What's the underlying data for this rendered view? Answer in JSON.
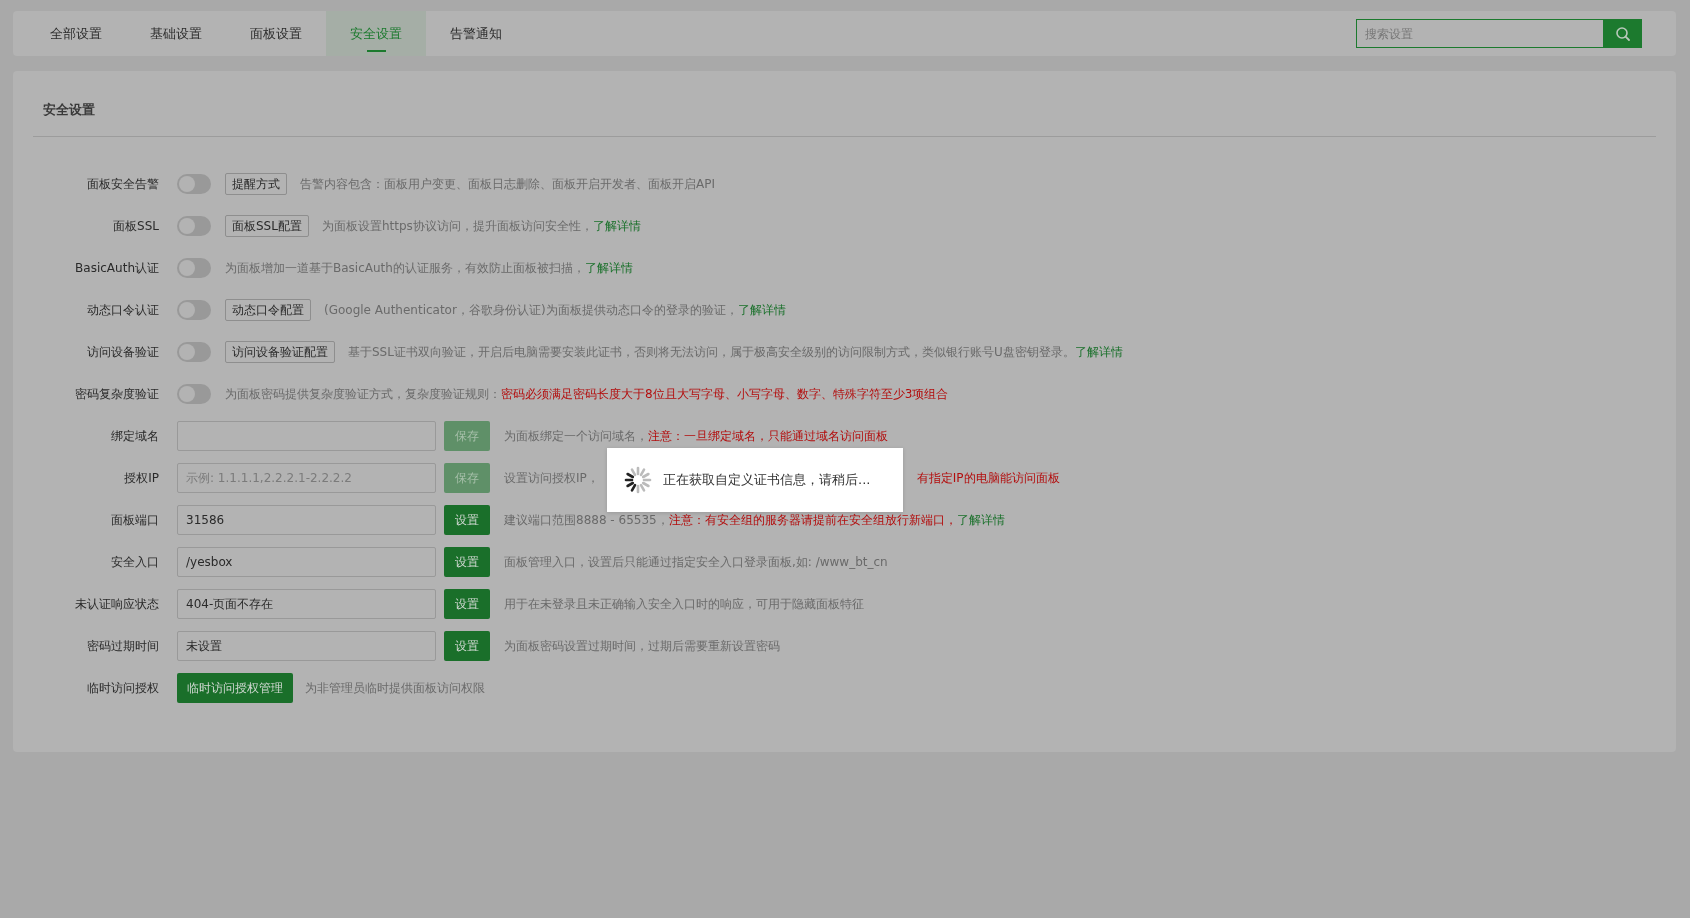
{
  "tabs": [
    {
      "label": "全部设置",
      "selected": false
    },
    {
      "label": "基础设置",
      "selected": false
    },
    {
      "label": "面板设置",
      "selected": false
    },
    {
      "label": "安全设置",
      "selected": true
    },
    {
      "label": "告警通知",
      "selected": false
    }
  ],
  "search": {
    "placeholder": "搜索设置"
  },
  "section": {
    "title": "安全设置"
  },
  "rows": [
    {
      "kind": "toggle",
      "label": "面板安全告警",
      "on": false,
      "button": "提醒方式",
      "description": [
        {
          "kind": "normal",
          "text": "告警内容包含：面板用户变更、面板日志删除、面板开启开发者、面板开启API"
        }
      ]
    },
    {
      "kind": "toggle",
      "label": "面板SSL",
      "on": false,
      "button": "面板SSL配置",
      "description": [
        {
          "kind": "normal",
          "text": "为面板设置https协议访问，提升面板访问安全性，"
        },
        {
          "kind": "link",
          "text": "了解详情"
        }
      ]
    },
    {
      "kind": "toggle",
      "label": "BasicAuth认证",
      "on": false,
      "description": [
        {
          "kind": "normal",
          "text": "为面板增加一道基于BasicAuth的认证服务，有效防止面板被扫描，"
        },
        {
          "kind": "link",
          "text": "了解详情"
        }
      ]
    },
    {
      "kind": "toggle",
      "label": "动态口令认证",
      "on": false,
      "button": "动态口令配置",
      "description": [
        {
          "kind": "normal",
          "text": "(Google Authenticator，谷歌身份认证)为面板提供动态口令的登录的验证，"
        },
        {
          "kind": "link",
          "text": "了解详情"
        }
      ]
    },
    {
      "kind": "toggle",
      "label": "访问设备验证",
      "on": false,
      "button": "访问设备验证配置",
      "description": [
        {
          "kind": "normal",
          "text": "基于SSL证书双向验证，开启后电脑需要安装此证书，否则将无法访问，属于极高安全级别的访问限制方式，类似银行账号U盘密钥登录。"
        },
        {
          "kind": "link",
          "text": "了解详情"
        }
      ]
    },
    {
      "kind": "toggle",
      "label": "密码复杂度验证",
      "on": false,
      "description": [
        {
          "kind": "normal",
          "text": "为面板密码提供复杂度验证方式，复杂度验证规则："
        },
        {
          "kind": "warn",
          "text": "密码必须满足密码长度大于8位且大写字母、小写字母、数字、特殊字符至少3项组合"
        }
      ]
    },
    {
      "kind": "input",
      "label": "绑定域名",
      "button": "保存",
      "disabled": true,
      "description": [
        {
          "kind": "normal",
          "text": "为面板绑定一个访问域名，"
        },
        {
          "kind": "warn",
          "text": "注意：一旦绑定域名，只能通过域名访问面板"
        }
      ]
    },
    {
      "kind": "input",
      "label": "授权IP",
      "placeholder": "示例: 1.1.1.1,2.2.2.1-2.2.2.2",
      "button": "保存",
      "disabled": true,
      "description": [
        {
          "kind": "normal",
          "text": "设置访问授权IP，"
        },
        {
          "kind": "warn",
          "text": "有指定IP的电脑能访问面板",
          "covered_before": true
        }
      ]
    },
    {
      "kind": "input",
      "label": "面板端口",
      "value": "31586",
      "button": "设置",
      "disabled": false,
      "description": [
        {
          "kind": "normal",
          "text": "建议端口范围8888 - 65535，"
        },
        {
          "kind": "warn",
          "text": "注意：有安全组的服务器请提前在安全组放行新端口，"
        },
        {
          "kind": "link",
          "text": "了解详情"
        }
      ]
    },
    {
      "kind": "input",
      "label": "安全入口",
      "value": "/yesbox",
      "button": "设置",
      "disabled": false,
      "description": [
        {
          "kind": "normal",
          "text": "面板管理入口，设置后只能通过指定安全入口登录面板,如: /www_bt_cn"
        }
      ]
    },
    {
      "kind": "input",
      "label": "未认证响应状态",
      "value": "404-页面不存在",
      "button": "设置",
      "disabled": false,
      "description": [
        {
          "kind": "normal",
          "text": "用于在未登录且未正确输入安全入口时的响应，可用于隐藏面板特征"
        }
      ]
    },
    {
      "kind": "input",
      "label": "密码过期时间",
      "value": "未设置",
      "button": "设置",
      "disabled": false,
      "description": [
        {
          "kind": "normal",
          "text": "为面板密码设置过期时间，过期后需要重新设置密码"
        }
      ]
    },
    {
      "kind": "action",
      "label": "临时访问授权",
      "button": "临时访问授权管理",
      "description": [
        {
          "kind": "normal",
          "text": "为非管理员临时提供面板访问权限"
        }
      ]
    }
  ],
  "toast": {
    "message": "正在获取自定义证书信息，请稍后..."
  }
}
